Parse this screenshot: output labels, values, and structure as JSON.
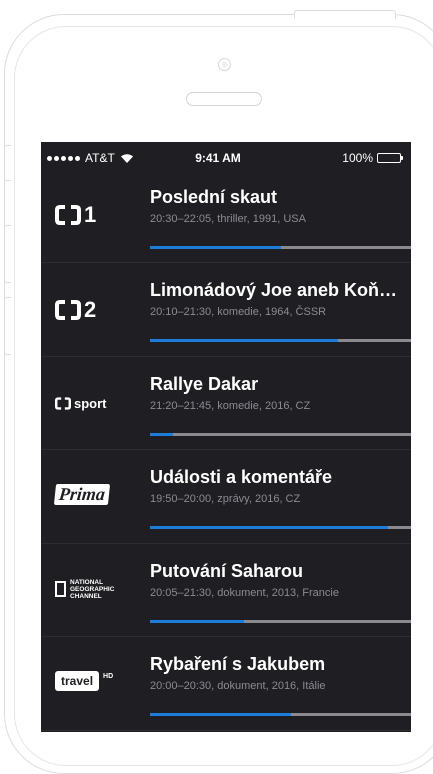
{
  "status_bar": {
    "carrier": "AT&T",
    "time": "9:41 AM",
    "battery": "100%"
  },
  "accent_color": "#1e7ddb",
  "channels": [
    {
      "logo": "ct1",
      "logo_text": "1",
      "title": "Poslední skaut",
      "meta": "20:30–22:05, thriller, 1991, USA",
      "progress": 0.5
    },
    {
      "logo": "ct2",
      "logo_text": "2",
      "title": "Limonádový Joe aneb Koňská opera",
      "meta": "20:10–21:30, komedie, 1964, ČSSR",
      "progress": 0.72
    },
    {
      "logo": "ctsport",
      "logo_text": "sport",
      "title": "Rallye Dakar",
      "meta": "21:20–21:45, komedie, 2016, CZ",
      "progress": 0.09
    },
    {
      "logo": "prima",
      "logo_text": "Prima",
      "title": "Události a komentáře",
      "meta": "19:50–20:00, zprávy, 2016, CZ",
      "progress": 0.91
    },
    {
      "logo": "natgeo",
      "logo_text": "NATIONAL GEOGRAPHIC CHANNEL",
      "title": "Putování Saharou",
      "meta": "20:05–21:30, dokument, 2013, Francie",
      "progress": 0.36
    },
    {
      "logo": "travel",
      "logo_text": "travel",
      "title": "Rybaření s Jakubem",
      "meta": "20:00–20:30, dokument, 2016, Itálie",
      "progress": 0.54
    }
  ]
}
